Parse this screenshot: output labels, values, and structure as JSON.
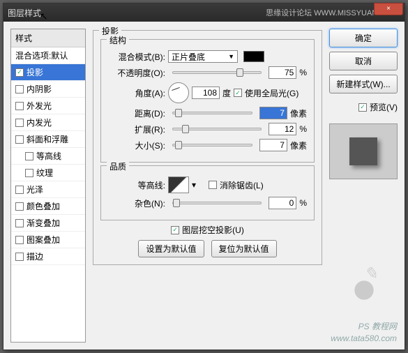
{
  "window": {
    "title": "图层样式",
    "brand": "思缘设计论坛 WWW.MISSYUAN.COM",
    "close": "×"
  },
  "left": {
    "header": "样式",
    "items": [
      {
        "label": "混合选项:默认",
        "checked": null
      },
      {
        "label": "投影",
        "checked": true,
        "selected": true
      },
      {
        "label": "内阴影",
        "checked": false
      },
      {
        "label": "外发光",
        "checked": false
      },
      {
        "label": "内发光",
        "checked": false
      },
      {
        "label": "斜面和浮雕",
        "checked": false
      },
      {
        "label": "等高线",
        "checked": false,
        "indent": true
      },
      {
        "label": "纹理",
        "checked": false,
        "indent": true
      },
      {
        "label": "光泽",
        "checked": false
      },
      {
        "label": "颜色叠加",
        "checked": false
      },
      {
        "label": "渐变叠加",
        "checked": false
      },
      {
        "label": "图案叠加",
        "checked": false
      },
      {
        "label": "描边",
        "checked": false
      }
    ]
  },
  "main": {
    "title": "投影",
    "struct": {
      "title": "结构",
      "blend_label": "混合模式(B):",
      "blend_value": "正片叠底",
      "opacity_label": "不透明度(O):",
      "opacity_value": "75",
      "opacity_unit": "%",
      "angle_label": "角度(A):",
      "angle_value": "108",
      "angle_unit": "度",
      "global_label": "使用全局光(G)",
      "global_checked": true,
      "dist_label": "距离(D):",
      "dist_value": "7",
      "dist_unit": "像素",
      "dist_sel": true,
      "spread_label": "扩展(R):",
      "spread_value": "12",
      "spread_unit": "%",
      "size_label": "大小(S):",
      "size_value": "7",
      "size_unit": "像素"
    },
    "qual": {
      "title": "品质",
      "contour_label": "等高线:",
      "aa_label": "消除锯齿(L)",
      "aa_checked": false,
      "noise_label": "杂色(N):",
      "noise_value": "0",
      "noise_unit": "%"
    },
    "knockout": {
      "label": "图层挖空投影(U)",
      "checked": true
    },
    "defbtn1": "设置为默认值",
    "defbtn2": "复位为默认值"
  },
  "right": {
    "ok": "确定",
    "cancel": "取消",
    "newstyle": "新建样式(W)...",
    "preview_label": "预览(V)",
    "preview_checked": true
  },
  "watermark": {
    "text1": "PS 教程网",
    "text2": "www.tata580.com"
  }
}
